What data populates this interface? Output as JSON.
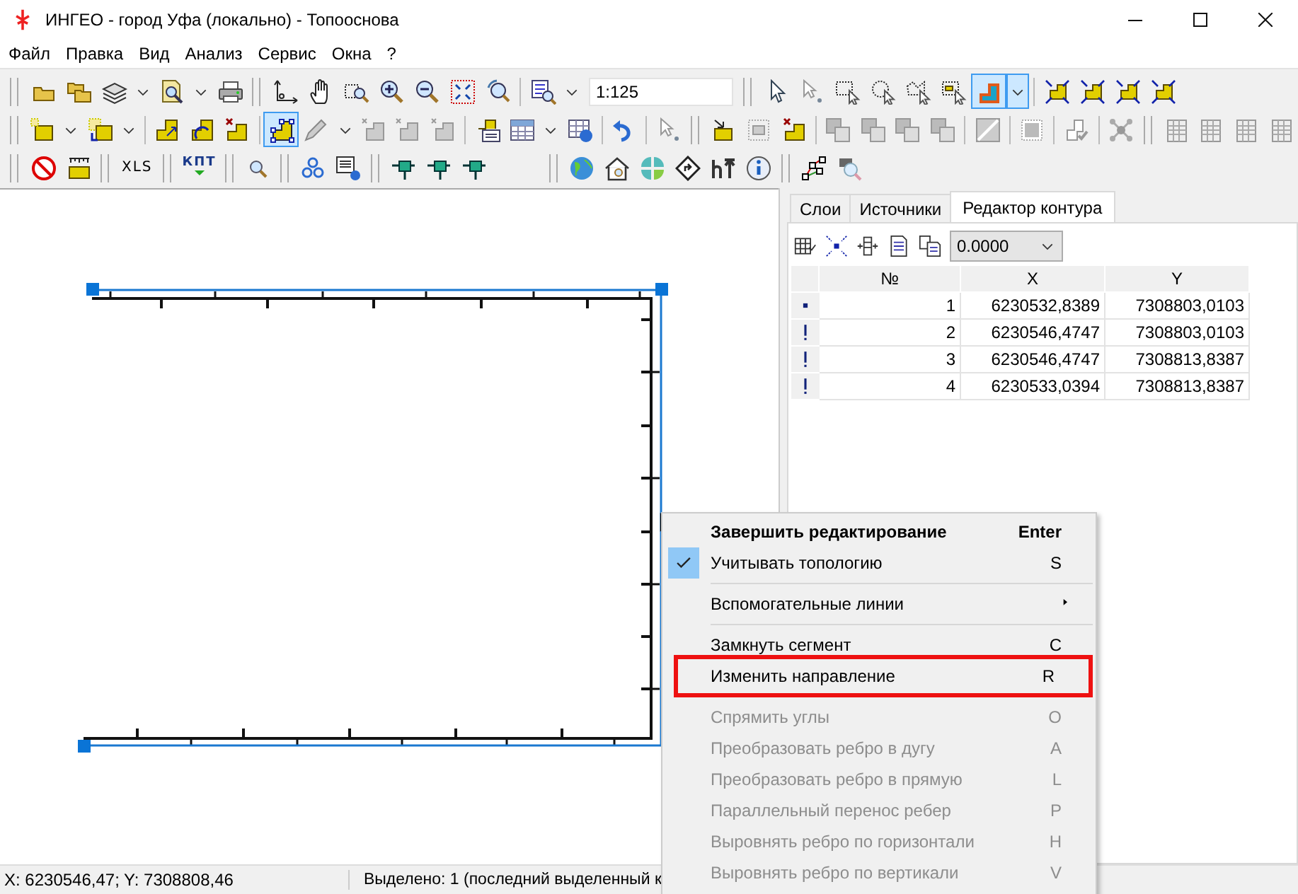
{
  "window": {
    "title": "ИНГЕО - город Уфа (локально) - Топооснова"
  },
  "menu_bar": [
    "Файл",
    "Правка",
    "Вид",
    "Анализ",
    "Сервис",
    "Окна",
    "?"
  ],
  "toolbars": [
    {
      "items": [
        {
          "kind": "grip"
        },
        {
          "kind": "button",
          "pressed": false
        },
        {
          "kind": "button",
          "pressed": false
        },
        {
          "kind": "button",
          "pressed": false
        },
        {
          "kind": "dropdown",
          "pressed": false
        },
        {
          "kind": "button",
          "pressed": false
        },
        {
          "kind": "dropdown",
          "pressed": false
        },
        {
          "kind": "button",
          "pressed": false
        },
        {
          "kind": "grip"
        },
        {
          "kind": "button",
          "pressed": false
        },
        {
          "kind": "button",
          "pressed": false
        },
        {
          "kind": "button",
          "pressed": false
        },
        {
          "kind": "button",
          "pressed": false
        },
        {
          "kind": "button",
          "pressed": false
        },
        {
          "kind": "button",
          "pressed": false
        },
        {
          "kind": "button",
          "pressed": false
        },
        {
          "kind": "separator"
        },
        {
          "kind": "button",
          "pressed": false
        },
        {
          "kind": "dropdown",
          "pressed": false
        },
        {
          "kind": "field",
          "value": "1:125"
        },
        {
          "kind": "grip"
        },
        {
          "kind": "button",
          "pressed": false
        },
        {
          "kind": "button",
          "pressed": false
        },
        {
          "kind": "button",
          "pressed": false
        },
        {
          "kind": "button",
          "pressed": false
        },
        {
          "kind": "button",
          "pressed": false
        },
        {
          "kind": "button",
          "pressed": false
        },
        {
          "kind": "button",
          "pressed": true
        },
        {
          "kind": "dropdown",
          "pressed": true
        },
        {
          "kind": "separator"
        },
        {
          "kind": "button",
          "pressed": false
        },
        {
          "kind": "button",
          "pressed": false
        },
        {
          "kind": "button",
          "pressed": false
        },
        {
          "kind": "button",
          "pressed": false
        }
      ]
    },
    {
      "items": [
        {
          "kind": "grip"
        },
        {
          "kind": "button",
          "pressed": false
        },
        {
          "kind": "dropdown",
          "pressed": false
        },
        {
          "kind": "button",
          "pressed": false
        },
        {
          "kind": "dropdown",
          "pressed": false
        },
        {
          "kind": "separator"
        },
        {
          "kind": "button",
          "pressed": false
        },
        {
          "kind": "button",
          "pressed": false
        },
        {
          "kind": "button",
          "pressed": false
        },
        {
          "kind": "separator"
        },
        {
          "kind": "button",
          "pressed": true
        },
        {
          "kind": "button",
          "pressed": false
        },
        {
          "kind": "dropdown",
          "pressed": false
        },
        {
          "kind": "button",
          "pressed": false
        },
        {
          "kind": "button",
          "pressed": false
        },
        {
          "kind": "button",
          "pressed": false
        },
        {
          "kind": "separator"
        },
        {
          "kind": "button",
          "pressed": false
        },
        {
          "kind": "button",
          "pressed": false
        },
        {
          "kind": "dropdown",
          "pressed": false
        },
        {
          "kind": "button",
          "pressed": false
        },
        {
          "kind": "separator"
        },
        {
          "kind": "button",
          "pressed": false
        },
        {
          "kind": "separator"
        },
        {
          "kind": "button",
          "pressed": false
        },
        {
          "kind": "grip"
        },
        {
          "kind": "button",
          "pressed": false
        },
        {
          "kind": "button",
          "pressed": false
        },
        {
          "kind": "button",
          "pressed": false
        },
        {
          "kind": "separator"
        },
        {
          "kind": "button",
          "pressed": false
        },
        {
          "kind": "button",
          "pressed": false
        },
        {
          "kind": "button",
          "pressed": false
        },
        {
          "kind": "button",
          "pressed": false
        },
        {
          "kind": "separator"
        },
        {
          "kind": "button",
          "pressed": false
        },
        {
          "kind": "separator"
        },
        {
          "kind": "button",
          "pressed": false
        },
        {
          "kind": "separator"
        },
        {
          "kind": "button",
          "pressed": false
        },
        {
          "kind": "separator"
        },
        {
          "kind": "button",
          "pressed": false
        },
        {
          "kind": "grip"
        },
        {
          "kind": "button",
          "pressed": false
        },
        {
          "kind": "button",
          "pressed": false
        },
        {
          "kind": "button",
          "pressed": false
        },
        {
          "kind": "button",
          "pressed": false
        }
      ]
    },
    {
      "items": [
        {
          "kind": "grip"
        },
        {
          "kind": "button",
          "pressed": false
        },
        {
          "kind": "button",
          "pressed": false
        },
        {
          "kind": "grip"
        },
        {
          "kind": "label_button",
          "label": "XLS"
        },
        {
          "kind": "grip"
        },
        {
          "kind": "label_arrow_button",
          "label": "КПТ"
        },
        {
          "kind": "grip"
        },
        {
          "kind": "button",
          "pressed": false
        },
        {
          "kind": "grip"
        },
        {
          "kind": "button",
          "pressed": false
        },
        {
          "kind": "button",
          "pressed": false
        },
        {
          "kind": "grip"
        },
        {
          "kind": "button",
          "pressed": false
        },
        {
          "kind": "button",
          "pressed": false
        },
        {
          "kind": "button",
          "pressed": false
        },
        {
          "kind": "wide_grip"
        },
        {
          "kind": "button",
          "pressed": false
        },
        {
          "kind": "button",
          "pressed": false
        },
        {
          "kind": "button",
          "pressed": false
        },
        {
          "kind": "button",
          "pressed": false
        },
        {
          "kind": "button",
          "pressed": false
        },
        {
          "kind": "button",
          "pressed": false
        },
        {
          "kind": "grip"
        },
        {
          "kind": "button",
          "pressed": false
        },
        {
          "kind": "button",
          "pressed": false
        }
      ]
    }
  ],
  "panel": {
    "tabs": [
      {
        "label": "Слои",
        "selected": false
      },
      {
        "label": "Источники",
        "selected": false
      },
      {
        "label": "Редактор контура",
        "selected": true
      }
    ],
    "precision": {
      "value": "0.0000"
    },
    "table": {
      "columns": [
        "№",
        "X",
        "Y"
      ],
      "rows": [
        {
          "kind": "start",
          "cells": [
            "1",
            "6230532,8389",
            "7308803,0103"
          ]
        },
        {
          "kind": "vertex",
          "cells": [
            "2",
            "6230546,4747",
            "7308803,0103"
          ]
        },
        {
          "kind": "vertex",
          "cells": [
            "3",
            "6230546,4747",
            "7308813,8387"
          ]
        },
        {
          "kind": "vertex",
          "cells": [
            "4",
            "6230533,0394",
            "7308813,8387"
          ]
        }
      ]
    }
  },
  "context_menu": {
    "items": [
      {
        "kind": "item",
        "label": "Завершить редактирование",
        "shortcut": "Enter",
        "default": true,
        "checked": false,
        "disabled": false,
        "submenu": false,
        "highlighted": false
      },
      {
        "kind": "item",
        "label": "Учитывать топологию",
        "shortcut": "S",
        "default": false,
        "checked": true,
        "disabled": false,
        "submenu": false,
        "highlighted": false
      },
      {
        "kind": "separator"
      },
      {
        "kind": "item",
        "label": "Вспомогательные линии",
        "default": false,
        "checked": false,
        "disabled": false,
        "submenu": true,
        "highlighted": false
      },
      {
        "kind": "separator"
      },
      {
        "kind": "item",
        "label": "Замкнуть сегмент",
        "shortcut": "C",
        "default": false,
        "checked": false,
        "disabled": false,
        "submenu": false,
        "highlighted": false
      },
      {
        "kind": "item",
        "label": "Изменить направление",
        "shortcut": "R",
        "default": false,
        "checked": false,
        "disabled": false,
        "submenu": false,
        "highlighted": true
      },
      {
        "kind": "separator"
      },
      {
        "kind": "item",
        "label": "Спрямить углы",
        "shortcut": "O",
        "default": false,
        "checked": false,
        "disabled": true,
        "submenu": false,
        "highlighted": false
      },
      {
        "kind": "item",
        "label": "Преобразовать ребро в дугу",
        "shortcut": "A",
        "default": false,
        "checked": false,
        "disabled": true,
        "submenu": false,
        "highlighted": false
      },
      {
        "kind": "item",
        "label": "Преобразовать ребро в прямую",
        "shortcut": "L",
        "default": false,
        "checked": false,
        "disabled": true,
        "submenu": false,
        "highlighted": false
      },
      {
        "kind": "item",
        "label": "Параллельный перенос ребер",
        "shortcut": "P",
        "default": false,
        "checked": false,
        "disabled": true,
        "submenu": false,
        "highlighted": false
      },
      {
        "kind": "item",
        "label": "Выровнять ребро по горизонтали",
        "shortcut": "H",
        "default": false,
        "checked": false,
        "disabled": true,
        "submenu": false,
        "highlighted": false
      },
      {
        "kind": "item",
        "label": "Выровнять ребро по вертикали",
        "shortcut": "V",
        "default": false,
        "checked": false,
        "disabled": true,
        "submenu": false,
        "highlighted": false
      }
    ]
  },
  "status_bar": [
    "X: 6230546,47; Y: 7308808,46",
    "Выделено: 1 (последний выделенный к"
  ]
}
